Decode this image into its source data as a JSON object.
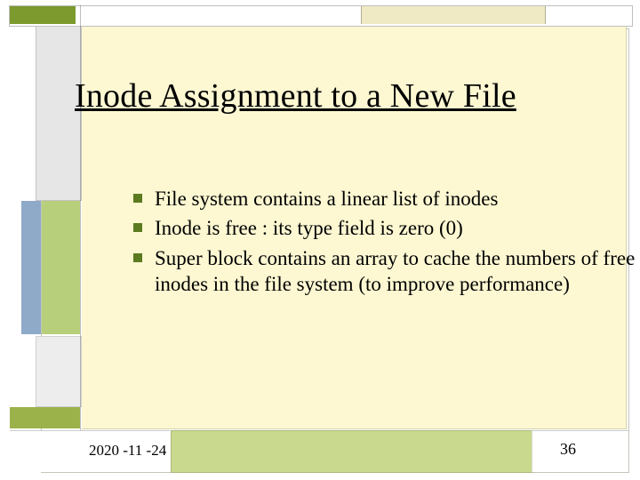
{
  "title": "Inode Assignment to a New File",
  "bullets": [
    "File system contains a linear list of inodes",
    "Inode is free : its type field is zero (0)",
    "Super block contains an array to cache the numbers of free inodes in the file system (to improve performance)"
  ],
  "footer": {
    "date": "2020 -11 -24",
    "page": "36"
  },
  "colors": {
    "panel_bg": "#fdf8d2",
    "bullet_square": "#5c7a1f",
    "accent_olive": "#7d9a2e",
    "accent_green": "#b7cf7a",
    "accent_blue": "#8fa9c9",
    "bottom_bar": "#c9d98e"
  }
}
